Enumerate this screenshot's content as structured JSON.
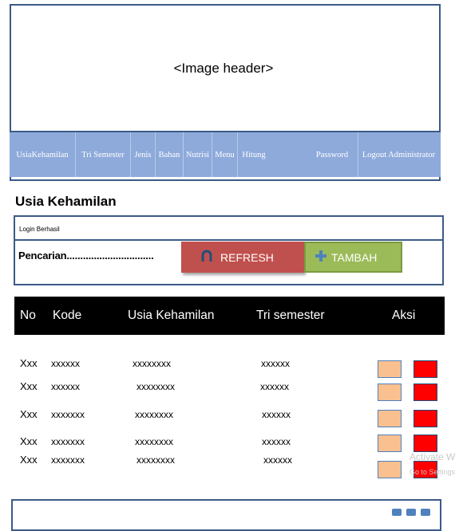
{
  "header": {
    "image_text": "<Image header>"
  },
  "nav": {
    "items": [
      {
        "label": "UsiaKehamilan"
      },
      {
        "label": "Tri Semester"
      },
      {
        "label": "Jenis"
      },
      {
        "label": "Bahan"
      },
      {
        "label": "Nutrisi"
      },
      {
        "label": "Menu"
      },
      {
        "label": "Hitung"
      },
      {
        "label": "Password"
      },
      {
        "label": "Logout Administrator"
      }
    ]
  },
  "page": {
    "title": "Usia Kehamilan"
  },
  "panel": {
    "login_message": "Login Berhasil",
    "search_label": "Pencarian................................",
    "refresh_label": "REFRESH",
    "tambah_label": "TAMBAH"
  },
  "table": {
    "columns": [
      "No",
      "Kode",
      "Usia Kehamilan",
      "Tri semester",
      "Aksi"
    ],
    "rows": [
      {
        "no": "Xxx",
        "kode": "xxxxxx",
        "usia": "xxxxxxxx",
        "tri": "xxxxxx"
      },
      {
        "no": "Xxx",
        "kode": "xxxxxx",
        "usia": "xxxxxxxx",
        "tri": "xxxxxx"
      },
      {
        "no": "Xxx",
        "kode": "xxxxxxx",
        "usia": "xxxxxxxx",
        "tri": "xxxxxx"
      },
      {
        "no": "Xxx",
        "kode": "xxxxxxx",
        "usia": "xxxxxxxx",
        "tri": "xxxxxx"
      },
      {
        "no": "Xxx",
        "kode": "xxxxxxx",
        "usia": "xxxxxxxx",
        "tri": "xxxxxx"
      }
    ]
  },
  "watermark": {
    "line1": "Activate W",
    "line2": "Go to Settings"
  },
  "colors": {
    "frame": "#3c5a86",
    "navbar": "#8eaadb",
    "refresh": "#c0504d",
    "tambah": "#9bbb59",
    "edit": "#fac090",
    "delete": "#ff0000"
  },
  "icons": {
    "refresh": "refresh-arc-icon",
    "tambah": "plus-icon"
  }
}
